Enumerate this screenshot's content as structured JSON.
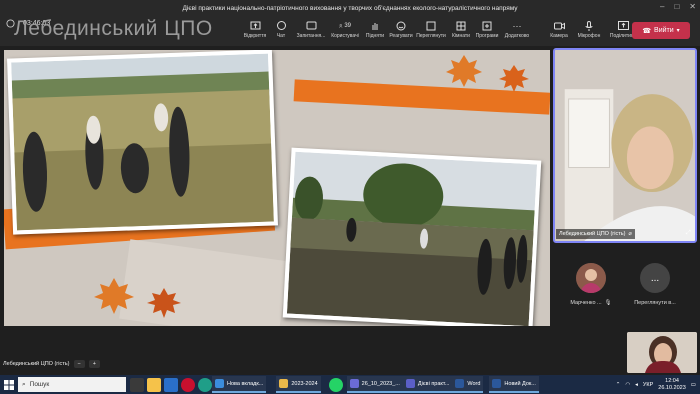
{
  "window": {
    "title": "Дієві практики національно-патріотичного виховання у творчих об'єднаннях еколого-натуралістичного напряму",
    "controls": [
      "–",
      "□",
      "✕"
    ]
  },
  "meeting": {
    "time": "03:46:03",
    "watermark": "Лебединський ЦПО"
  },
  "toolbar": {
    "items": [
      {
        "label": "Відкриття",
        "icon": "open-icon"
      },
      {
        "label": "Чат",
        "icon": "chat-icon"
      },
      {
        "label": "Запитання...",
        "icon": "qa-icon"
      },
      {
        "label": "Користувачі",
        "icon": "people-icon",
        "count": "39"
      },
      {
        "label": "Підняти",
        "icon": "raise-hand-icon"
      },
      {
        "label": "Реагувати",
        "icon": "react-icon"
      },
      {
        "label": "Переглянути",
        "icon": "view-icon"
      },
      {
        "label": "Кімнати",
        "icon": "rooms-icon"
      },
      {
        "label": "Програми",
        "icon": "apps-icon"
      },
      {
        "label": "Додатково",
        "icon": "more-icon"
      }
    ],
    "camera_label": "Камера",
    "mic_label": "Мікрофон",
    "share_label": "Поділитися",
    "leave_label": "Вийти"
  },
  "self_view": {
    "label": "Лебединський ЦПО (гість)"
  },
  "participants": [
    {
      "name": "Марченко ...",
      "icon": "avatar-photo"
    },
    {
      "name": "Переглянути в...",
      "icon": "more-icon",
      "avatar_text": "..."
    }
  ],
  "stage_label": {
    "name": "Лебединський ЦПО (гість)",
    "minus": "−",
    "plus": "+"
  },
  "taskbar": {
    "search_placeholder": "Пошук",
    "apps": [
      {
        "label": "Нова вкладк...",
        "color": "#3b8ddd"
      },
      {
        "label": "2023-2024",
        "color": "#e8b84a"
      },
      {
        "label": "26_10_2023_...",
        "color": "#6b6bd6"
      },
      {
        "label": "Дієві практ...",
        "color": "#5b5fc7"
      },
      {
        "label": "Word",
        "color": "#2b579a"
      },
      {
        "label": "Новий Док...",
        "color": "#2b579a"
      }
    ],
    "tray_lang": "УКР",
    "clock_time": "12:04",
    "clock_date": "26.10.2023"
  }
}
